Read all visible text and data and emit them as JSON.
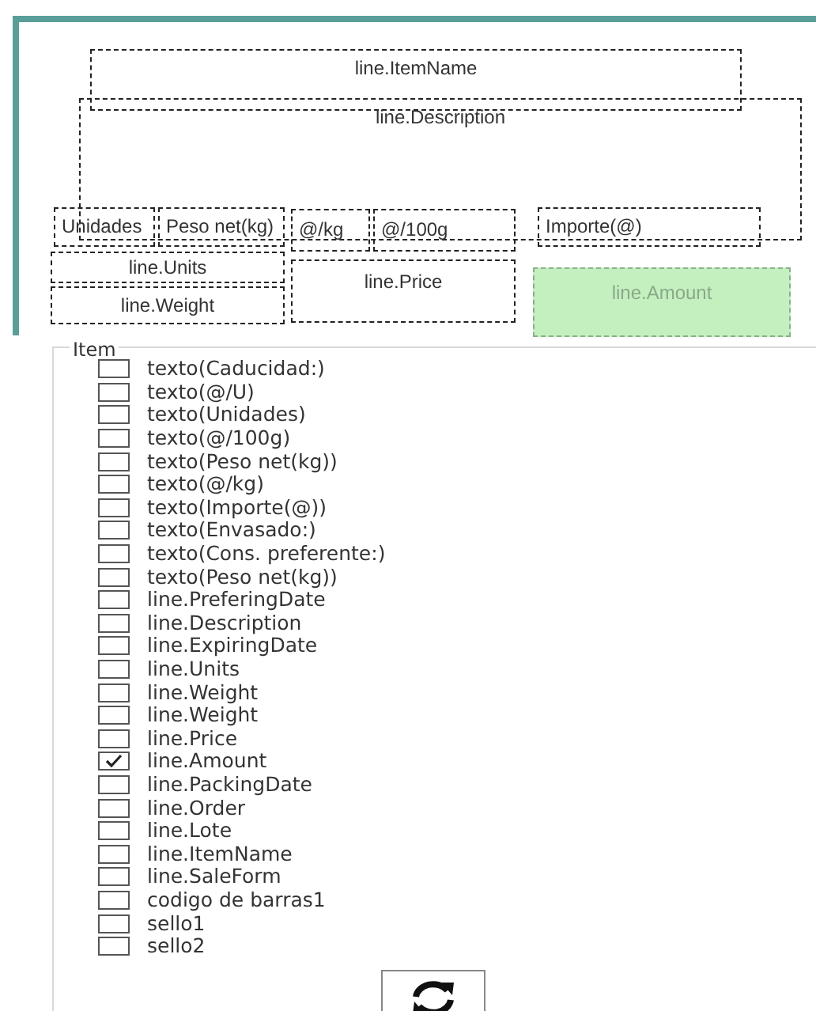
{
  "canvas": {
    "fields": [
      {
        "text": "line.ItemName",
        "selected": false
      },
      {
        "text": "line.Description",
        "selected": false
      },
      {
        "text": "Unidades",
        "selected": false
      },
      {
        "text": "Peso net(kg)",
        "selected": false
      },
      {
        "text": "@/kg",
        "selected": false
      },
      {
        "text": "@/100g",
        "selected": false
      },
      {
        "text": "Importe(@)",
        "selected": false
      },
      {
        "text": "line.Units",
        "selected": false
      },
      {
        "text": "line.Weight",
        "selected": false
      },
      {
        "text": "line.Price",
        "selected": false
      },
      {
        "text": "line.Amount",
        "selected": true
      }
    ]
  },
  "group": {
    "title": "Item",
    "items": [
      {
        "label": "texto(Caducidad:)",
        "checked": false
      },
      {
        "label": "texto(@/U)",
        "checked": false
      },
      {
        "label": "texto(Unidades)",
        "checked": false
      },
      {
        "label": "texto(@/100g)",
        "checked": false
      },
      {
        "label": "texto(Peso net(kg))",
        "checked": false
      },
      {
        "label": "texto(@/kg)",
        "checked": false
      },
      {
        "label": "texto(Importe(@))",
        "checked": false
      },
      {
        "label": "texto(Envasado:)",
        "checked": false
      },
      {
        "label": "texto(Cons. preferente:)",
        "checked": false
      },
      {
        "label": "texto(Peso net(kg))",
        "checked": false
      },
      {
        "label": "line.PreferingDate",
        "checked": false
      },
      {
        "label": "line.Description",
        "checked": false
      },
      {
        "label": "line.ExpiringDate",
        "checked": false
      },
      {
        "label": "line.Units",
        "checked": false
      },
      {
        "label": "line.Weight",
        "checked": false
      },
      {
        "label": "line.Weight",
        "checked": false
      },
      {
        "label": "line.Price",
        "checked": false
      },
      {
        "label": "line.Amount",
        "checked": true
      },
      {
        "label": "line.PackingDate",
        "checked": false
      },
      {
        "label": "line.Order",
        "checked": false
      },
      {
        "label": "line.Lote",
        "checked": false
      },
      {
        "label": "line.ItemName",
        "checked": false
      },
      {
        "label": "line.SaleForm",
        "checked": false
      },
      {
        "label": "codigo de barras1",
        "checked": false
      },
      {
        "label": "sello1",
        "checked": false
      },
      {
        "label": "sello2",
        "checked": false
      }
    ]
  }
}
